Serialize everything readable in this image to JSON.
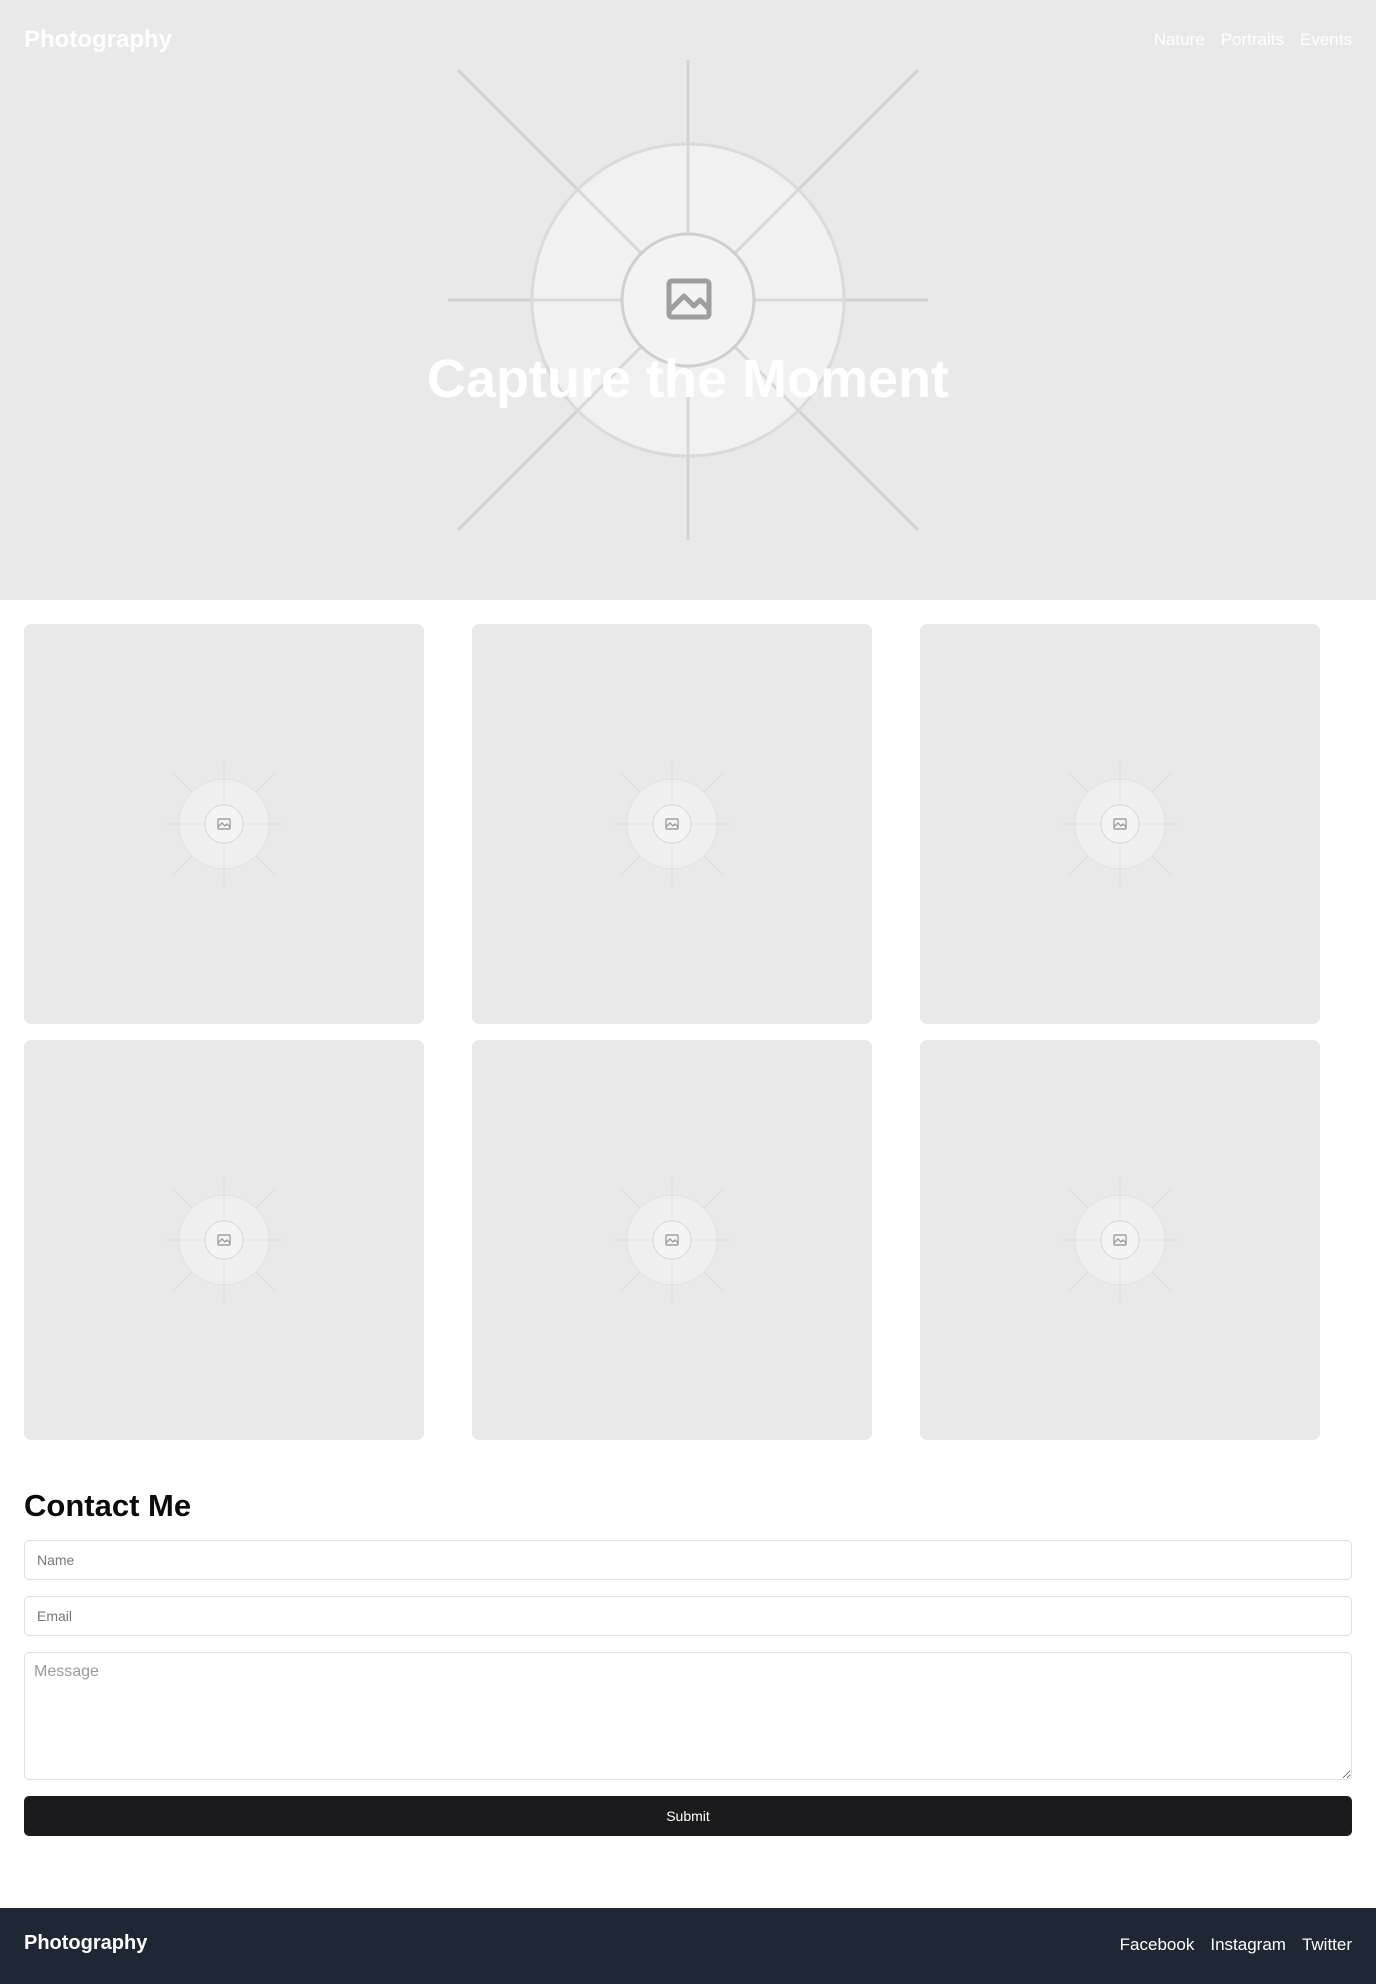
{
  "header": {
    "brand": "Photography",
    "nav": [
      "Nature",
      "Portraits",
      "Events"
    ]
  },
  "hero": {
    "title": "Capture the Moment",
    "image_icon": "image-placeholder-icon"
  },
  "gallery": {
    "tile_icon": "image-placeholder-icon",
    "tile_count": 6
  },
  "contact": {
    "title": "Contact Me",
    "name_placeholder": "Name",
    "email_placeholder": "Email",
    "message_placeholder": "Message",
    "submit_label": "Submit"
  },
  "footer": {
    "brand": "Photography",
    "links": [
      "Facebook",
      "Instagram",
      "Twitter"
    ]
  },
  "colors": {
    "placeholder_bg": "#e9e9e9",
    "submit_bg": "#1b1b1d",
    "footer_bg": "#1f2734"
  }
}
